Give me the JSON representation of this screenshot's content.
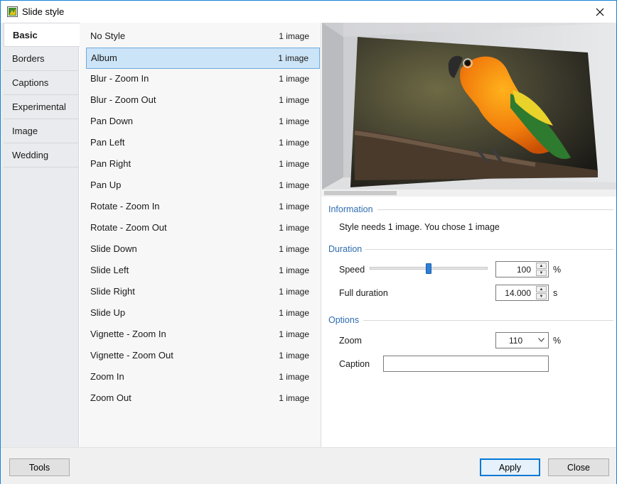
{
  "window": {
    "title": "Slide style",
    "icon": "slide-style-app-icon",
    "close_icon": "close-icon"
  },
  "tabs": [
    {
      "label": "Basic",
      "active": true
    },
    {
      "label": "Borders",
      "active": false
    },
    {
      "label": "Captions",
      "active": false
    },
    {
      "label": "Experimental",
      "active": false
    },
    {
      "label": "Image",
      "active": false
    },
    {
      "label": "Wedding",
      "active": false
    }
  ],
  "styles": [
    {
      "name": "No Style",
      "count": "1 image"
    },
    {
      "name": "Album",
      "count": "1 image",
      "selected": true
    },
    {
      "name": "Blur - Zoom In",
      "count": "1 image"
    },
    {
      "name": "Blur - Zoom Out",
      "count": "1 image"
    },
    {
      "name": "Pan Down",
      "count": "1 image"
    },
    {
      "name": "Pan Left",
      "count": "1 image"
    },
    {
      "name": "Pan Right",
      "count": "1 image"
    },
    {
      "name": "Pan Up",
      "count": "1 image"
    },
    {
      "name": "Rotate - Zoom In",
      "count": "1 image"
    },
    {
      "name": "Rotate - Zoom Out",
      "count": "1 image"
    },
    {
      "name": "Slide Down",
      "count": "1 image"
    },
    {
      "name": "Slide Left",
      "count": "1 image"
    },
    {
      "name": "Slide Right",
      "count": "1 image"
    },
    {
      "name": "Slide Up",
      "count": "1 image"
    },
    {
      "name": "Vignette - Zoom In",
      "count": "1 image"
    },
    {
      "name": "Vignette - Zoom Out",
      "count": "1 image"
    },
    {
      "name": "Zoom In",
      "count": "1 image"
    },
    {
      "name": "Zoom Out",
      "count": "1 image"
    }
  ],
  "information": {
    "title": "Information",
    "message": "Style needs 1 image. You chose 1 image"
  },
  "duration": {
    "title": "Duration",
    "speed_label": "Speed",
    "speed_value": "100",
    "speed_unit": "%",
    "speed_slider_level": 0.5,
    "full_duration_label": "Full duration",
    "full_duration_value": "14.000",
    "full_duration_unit": "s"
  },
  "options": {
    "title": "Options",
    "zoom_label": "Zoom",
    "zoom_value": "110",
    "zoom_unit": "%",
    "caption_label": "Caption",
    "caption_value": ""
  },
  "buttons": {
    "tools": "Tools",
    "apply": "Apply",
    "close": "Close"
  },
  "colors": {
    "accent": "#0078d7",
    "section_title": "#2d6cb0",
    "selection": "#cce4f7"
  }
}
